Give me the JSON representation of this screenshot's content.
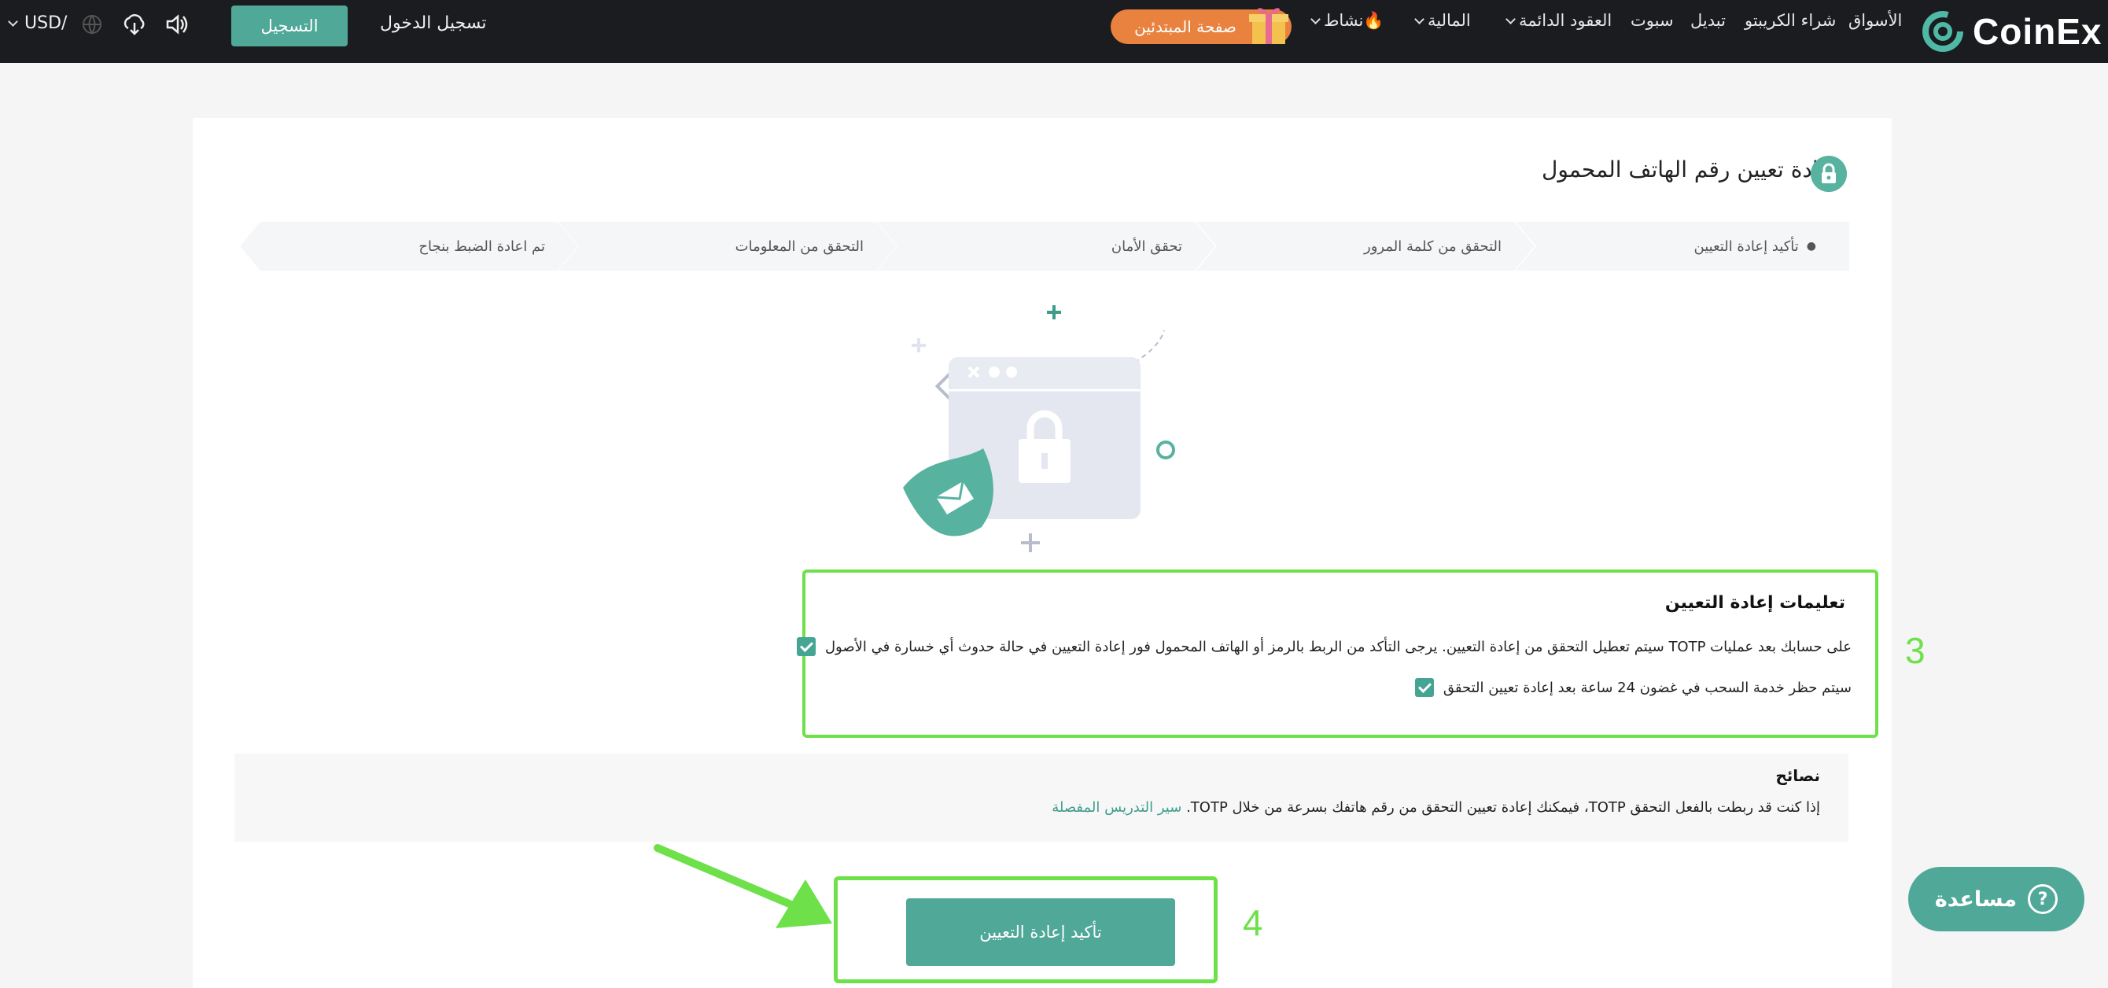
{
  "nav": {
    "brand": "CoinEx",
    "items": [
      {
        "label": "الأسواق",
        "has_dropdown": false
      },
      {
        "label": "شراء الكريبتو",
        "has_dropdown": false
      },
      {
        "label": "تبديل",
        "has_dropdown": false
      },
      {
        "label": "سبوت",
        "has_dropdown": false
      },
      {
        "label": "العقود الدائمة",
        "has_dropdown": true
      },
      {
        "label": "المالية",
        "has_dropdown": true
      },
      {
        "label": "نشاط",
        "has_dropdown": true
      }
    ],
    "beginner_label": "صفحة المبتدئين",
    "signup_label": "التسجيل",
    "login_label": "تسجيل الدخول",
    "currency": "USD/"
  },
  "page": {
    "title": "إعادة تعيين رقم الهاتف المحمول",
    "steps": [
      {
        "label": "تأكيد إعادة التعيين",
        "active": true
      },
      {
        "label": "التحقق من كلمة المرور",
        "active": false
      },
      {
        "label": "تحقق الأمان",
        "active": false
      },
      {
        "label": "التحقق من المعلومات",
        "active": false
      },
      {
        "label": "تم اعادة الضبط بنجاح",
        "active": false
      }
    ],
    "instructions": {
      "title": "تعليمات إعادة التعيين",
      "items": [
        "على حسابك بعد عمليات TOTP سيتم تعطيل التحقق من إعادة التعيين. يرجى التأكد من الربط بالرمز أو الهاتف المحمول فور إعادة التعيين في حالة حدوث أي خسارة في الأصول",
        "سيتم حظر خدمة السحب في غضون 24 ساعة بعد إعادة تعيين التحقق"
      ]
    },
    "tips": {
      "title": "نصائح",
      "text": "إذا كنت قد ربطت بالفعل التحقق TOTP، فيمكنك إعادة تعيين التحقق من رقم هاتفك بسرعة من خلال TOTP.",
      "link": "سير التدريس المفصلة"
    },
    "confirm_label": "تأكيد إعادة التعيين"
  },
  "annotations": {
    "box_3": "3",
    "box_4": "4"
  },
  "help_label": "مساعدة",
  "colors": {
    "accent": "#4fa898",
    "highlight": "#6ee04a",
    "beginner": "#e8823e",
    "topbar": "#1a1c1f"
  }
}
